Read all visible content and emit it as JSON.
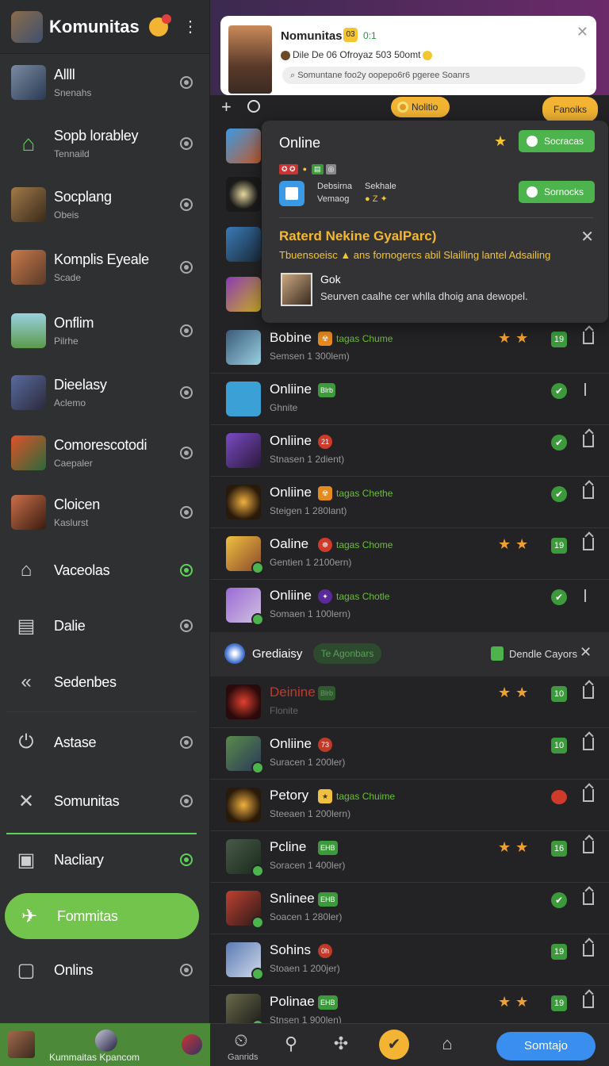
{
  "sidebar": {
    "title": "Komunitas",
    "items": [
      {
        "name": "Allll",
        "sub": "Snenahs"
      },
      {
        "name": "Sopb lorabley",
        "sub": "Tennaild"
      },
      {
        "name": "Socplang",
        "sub": "Obeis"
      },
      {
        "name": "Komplis Eyeale",
        "sub": "Scade"
      },
      {
        "name": "Onflim",
        "sub": "Pilrhe"
      },
      {
        "name": "Dieelasy",
        "sub": "Aclemo"
      },
      {
        "name": "Comorescotodi",
        "sub": "Caepaler"
      },
      {
        "name": "Cloicen",
        "sub": "Kaslurst"
      }
    ],
    "nav": [
      {
        "name": "Vaceolas"
      },
      {
        "name": "Dalie"
      },
      {
        "name": "Sedenbes"
      },
      {
        "name": "Astase"
      },
      {
        "name": "Somunitas"
      },
      {
        "name": "Nacliary"
      }
    ],
    "active": "Fommitas",
    "last": "Onlins",
    "footer_label": "Kummaitas Kpancom",
    "colors": {
      "accent": "#73c44d",
      "footer": "#4c8a39"
    }
  },
  "notification": {
    "title": "Nomunitas",
    "tag": "03",
    "count": "0:1",
    "meta": "Dile De   06 Ofroyaz 503 50omt",
    "search": "Somuntane foo2y oopepo6r6 pgeree Soanrs"
  },
  "toolbar": {
    "pill1": "Nolitio",
    "pill2": "Fanoiks"
  },
  "popover": {
    "status": "Online",
    "btn1": "Socracas",
    "btn2": "Sornocks",
    "line1a": "Debsirna",
    "line1b": "Vemaog",
    "line2a": "Sekhale",
    "line2b": "● Z ✦",
    "header": "Raterd Nekine GyalParc)",
    "desc": "Tbuensoeisc ▲ ans fornogercs abil Slailling lantel Adsailing",
    "person": "Gok",
    "message": "Seurven caalhe cer whlla dhoig ana dewopel."
  },
  "rows_a": [
    {
      "title": "Bobine",
      "sub": "Semsen 1 300lem)",
      "extra": "tagas Chume",
      "badge": "☢",
      "num": "19"
    },
    {
      "title": "Onliine",
      "sub": "Ghnite",
      "badge": "Blrb"
    },
    {
      "title": "Onliine",
      "sub": "Stnasen 1 2dient)",
      "badge": "21"
    },
    {
      "title": "Onliine",
      "sub": "Steigen 1 280lant)",
      "extra": "tagas Chethe",
      "badge": "☢"
    },
    {
      "title": "Oaline",
      "sub": "Gentien 1 2100ern)",
      "extra": "tagas Chome",
      "badge": "☸",
      "num": "19"
    },
    {
      "title": "Onliine",
      "sub": "Somaen 1 100lern)",
      "extra": "tagas Chotle",
      "badge": "✦"
    }
  ],
  "group": {
    "name": "Grediaisy",
    "pill": "Te Agonbars",
    "label": "Dendle Cayors"
  },
  "rows_b": [
    {
      "title": "Deinine",
      "sub": "Flonite",
      "badge": "Blrb",
      "num": "10"
    },
    {
      "title": "Onliine",
      "sub": "Suracen 1 200ler)",
      "badge": "73",
      "num": "10"
    },
    {
      "title": "Petory",
      "sub": "Steeaen 1 200lern)",
      "extra": "tagas Chuime",
      "badge": "★"
    },
    {
      "title": "Pcline",
      "sub": "Soracen 1 400ler)",
      "badge": "EHB",
      "num": "16"
    },
    {
      "title": "Snlinee",
      "sub": "Soacen 1 280ler)",
      "badge": "EHB"
    },
    {
      "title": "Sohins",
      "sub": "Stoaen 1 200jer)",
      "badge": "0h",
      "num": "19"
    },
    {
      "title": "Polinae",
      "sub": "Stnsen 1 900len)",
      "badge": "EHB",
      "num": "19"
    }
  ],
  "bottom": {
    "label": "Ganrids",
    "button": "Somtajo"
  }
}
